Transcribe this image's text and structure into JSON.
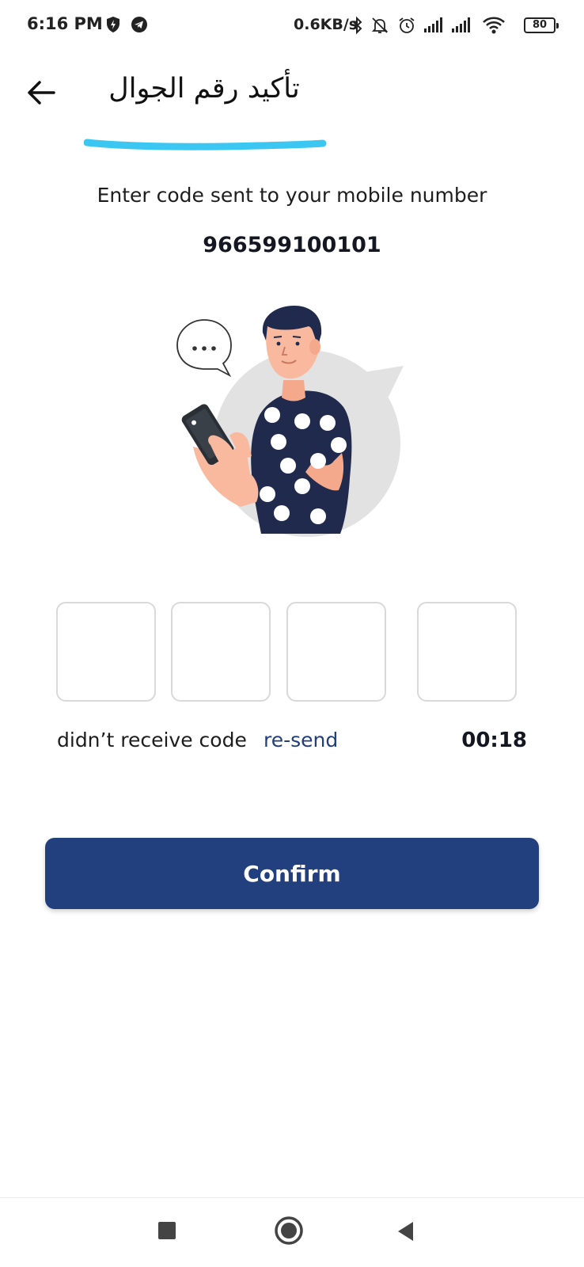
{
  "status_bar": {
    "time": "6:16 PM",
    "net_speed": "0.6KB/s",
    "battery": "80",
    "icons": [
      "shield-icon",
      "telegram-icon",
      "bluetooth-icon",
      "bell-muted-icon",
      "alarm-icon",
      "signal-icon",
      "signal-icon",
      "wifi-icon",
      "battery-icon"
    ]
  },
  "header": {
    "back_icon": "arrow-left-icon",
    "title": "تأكيد رقم الجوال",
    "underline_color": "#3cc7f2"
  },
  "verification": {
    "instruction": "Enter code sent to your mobile number",
    "phone_number": "966599100101",
    "otp_digits": [
      "",
      "",
      "",
      ""
    ],
    "no_code_text": "didn’t receive code",
    "resend_label": "re-send",
    "timer": "00:18"
  },
  "confirm_button": {
    "label": "Confirm",
    "color": "#223f7e"
  },
  "nav_bar": {
    "icons": [
      "square-recent-icon",
      "circle-home-icon",
      "triangle-back-icon"
    ]
  }
}
